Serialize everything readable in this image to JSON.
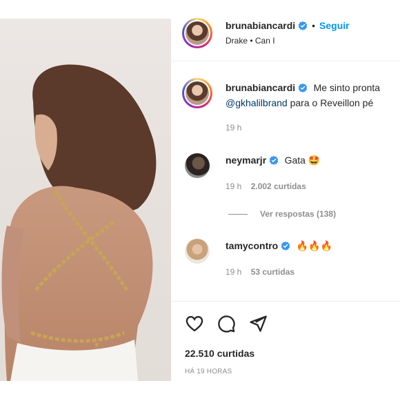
{
  "post": {
    "author": "brunabiancardi",
    "follow_label": "Seguir",
    "song": "Drake • Can I",
    "caption_line1": "Me sinto pronta",
    "caption_mention": "@gkhalilbrand",
    "caption_line2": " para o Reveillon pé",
    "caption_time": "19 h"
  },
  "comments": [
    {
      "user": "neymarjr",
      "text": "Gata 🤩",
      "time": "19 h",
      "likes": "2.002 curtidas"
    },
    {
      "user": "tamycontro",
      "text": "🔥🔥🔥",
      "time": "19 h",
      "likes": "53 curtidas"
    }
  ],
  "replies_label": "Ver respostas (138)",
  "likes_total": "22.510 curtidas",
  "posted_ago": "HÁ 19 HORAS",
  "colors": {
    "follow": "#0095f6",
    "verified": "#3897f0",
    "mention": "#00376b"
  }
}
